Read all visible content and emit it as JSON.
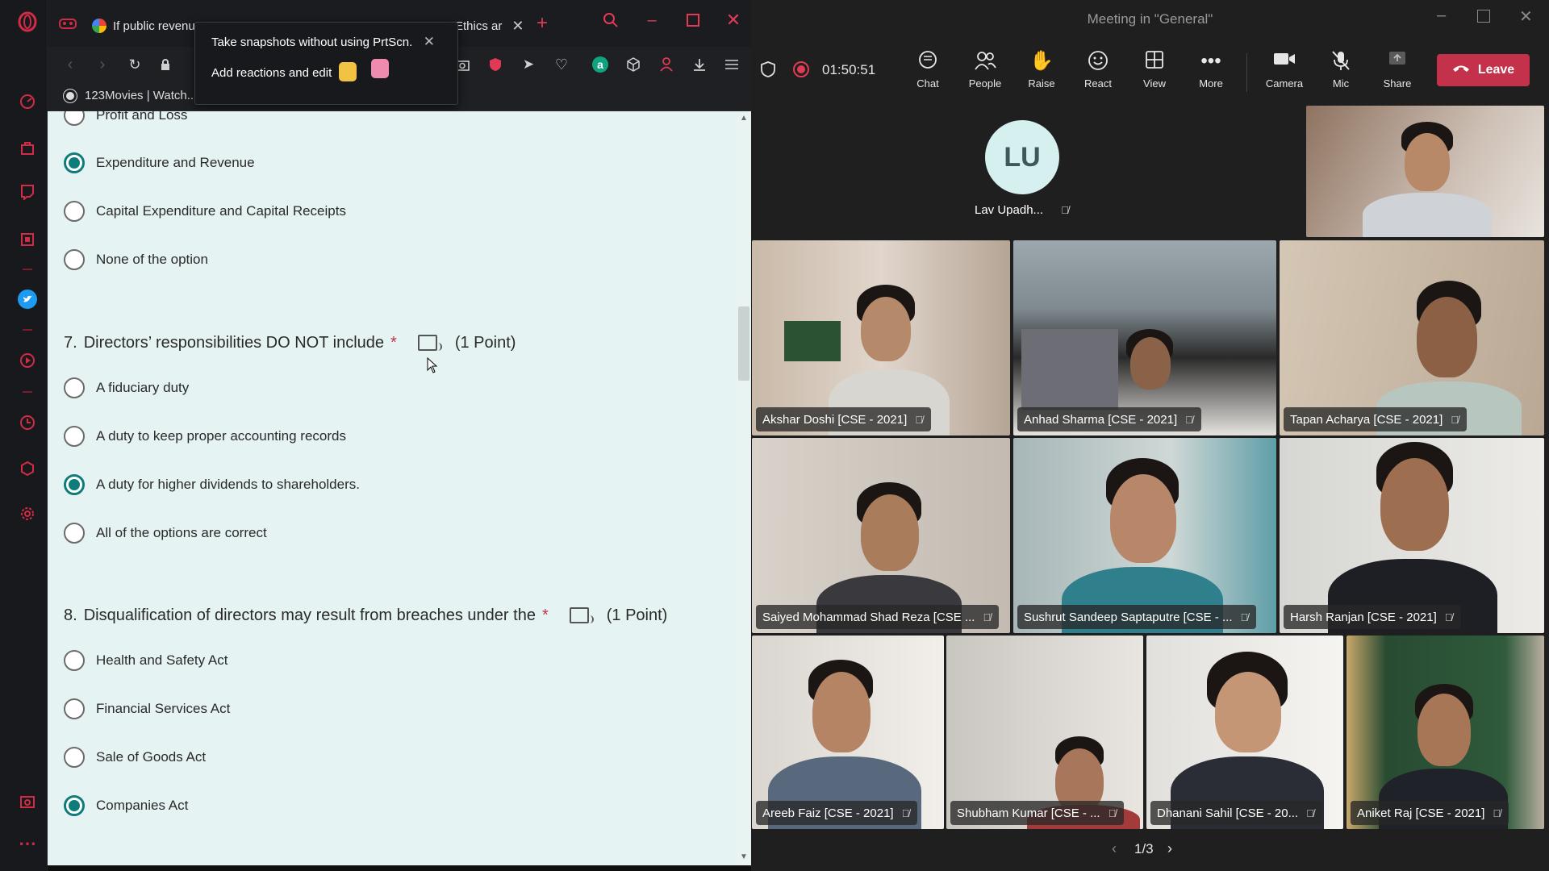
{
  "browser": {
    "tabs": [
      {
        "label": "If public revenu",
        "icon": "google-icon"
      },
      {
        "label": "Ethics ar",
        "icon": "close-icon"
      }
    ],
    "bookmark": "123Movies | Watch...",
    "tooltip": {
      "line1": "Take snapshots without using PrtScn.",
      "line2": "Add reactions and edit"
    }
  },
  "form": {
    "prev_options": [
      {
        "label": "Profit and Loss",
        "selected": false
      },
      {
        "label": "Expenditure and Revenue",
        "selected": true
      },
      {
        "label": "Capital Expenditure and Capital Receipts",
        "selected": false
      },
      {
        "label": "None of the option",
        "selected": false
      }
    ],
    "q7": {
      "number": "7.",
      "text": "Directors’ responsibilities DO NOT include",
      "required": "*",
      "points": "(1 Point)",
      "options": [
        {
          "label": "A fiduciary duty",
          "selected": false
        },
        {
          "label": "A duty to keep proper accounting records",
          "selected": false
        },
        {
          "label": "A duty for higher dividends to shareholders.",
          "selected": true
        },
        {
          "label": "All of the options are correct",
          "selected": false
        }
      ]
    },
    "q8": {
      "number": "8.",
      "text": "Disqualification of directors may result from breaches under the",
      "required": "*",
      "points": "(1 Point)",
      "options": [
        {
          "label": "Health and Safety Act",
          "selected": false
        },
        {
          "label": "Financial Services Act",
          "selected": false
        },
        {
          "label": "Sale of Goods Act",
          "selected": false
        },
        {
          "label": "Companies Act",
          "selected": true
        }
      ]
    }
  },
  "teams": {
    "window_title": "Meeting in \"General\"",
    "timer": "01:50:51",
    "controls": {
      "chat": "Chat",
      "people": "People",
      "raise": "Raise",
      "react": "React",
      "view": "View",
      "more": "More",
      "camera": "Camera",
      "mic": "Mic",
      "share": "Share",
      "leave": "Leave"
    },
    "audio_participant": {
      "initials": "LU",
      "name": "Lav Upadh..."
    },
    "participants": [
      {
        "name": "Akshar Doshi [CSE - 2021]"
      },
      {
        "name": "Anhad Sharma [CSE - 2021]"
      },
      {
        "name": "Tapan Acharya [CSE - 2021]"
      },
      {
        "name": "Saiyed Mohammad Shad Reza [CSE ..."
      },
      {
        "name": "Sushrut Sandeep Saptaputre [CSE - ..."
      },
      {
        "name": "Harsh Ranjan [CSE - 2021]"
      },
      {
        "name": "Areeb Faiz [CSE - 2021]"
      },
      {
        "name": "Shubham Kumar [CSE - ..."
      },
      {
        "name": "Dhanani Sahil [CSE - 20..."
      },
      {
        "name": "Aniket Raj [CSE - 2021]"
      }
    ],
    "pagination": "1/3"
  },
  "colors": {
    "teams_leave": "#c4314b",
    "radio_selected": "#0f7c7c",
    "opera_red": "#d22b45",
    "form_bg": "#e5f3f2"
  }
}
